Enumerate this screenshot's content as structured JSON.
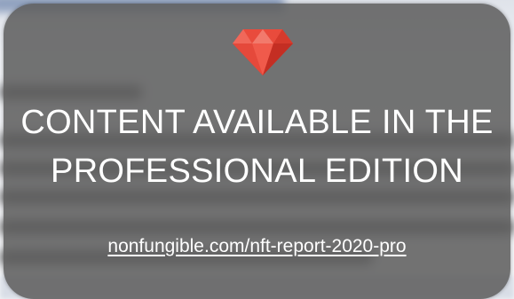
{
  "overlay": {
    "icon": "ruby-gem-icon",
    "icon_color": "#e53935",
    "headline_line1": "CONTENT AVAILABLE IN THE",
    "headline_line2": "PROFESSIONAL EDITION",
    "link_text": "nonfungible.com/nft-report-2020-pro",
    "background_color": "#606060",
    "text_color": "#ffffff"
  }
}
